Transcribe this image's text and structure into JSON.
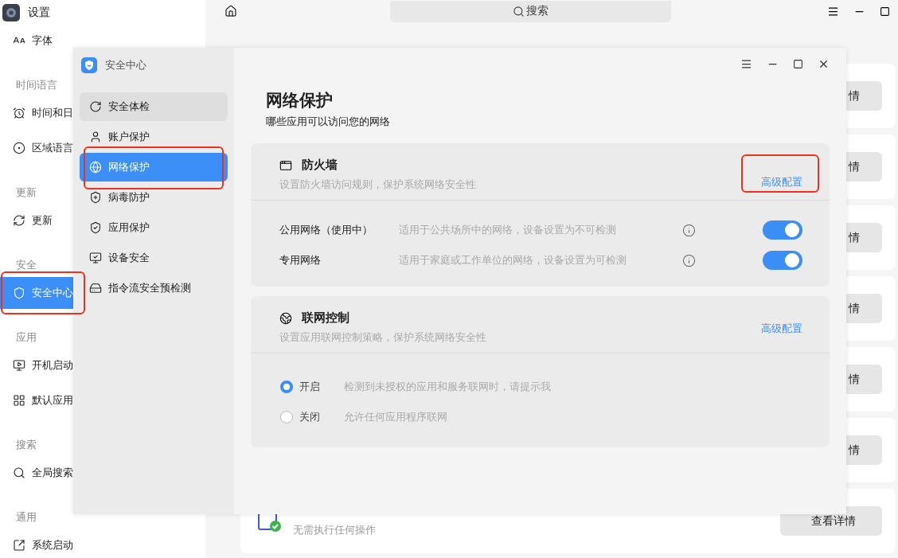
{
  "settings": {
    "title": "设置",
    "search": {
      "placeholder": "搜索"
    },
    "sidebar": [
      {
        "kind": "item",
        "label": "字体",
        "selected": false,
        "annotated": false
      },
      {
        "kind": "section",
        "label": "时间语言"
      },
      {
        "kind": "item",
        "label": "时间和日",
        "selected": false,
        "annotated": false
      },
      {
        "kind": "item",
        "label": "区域语言",
        "selected": false,
        "annotated": false
      },
      {
        "kind": "section",
        "label": "更新"
      },
      {
        "kind": "item",
        "label": "更新",
        "selected": false,
        "annotated": false
      },
      {
        "kind": "section",
        "label": "安全"
      },
      {
        "kind": "item",
        "label": "安全中心",
        "selected": true,
        "annotated": true
      },
      {
        "kind": "section",
        "label": "应用"
      },
      {
        "kind": "item",
        "label": "开机启动",
        "selected": false,
        "annotated": false
      },
      {
        "kind": "item",
        "label": "默认应用",
        "selected": false,
        "annotated": false
      },
      {
        "kind": "section",
        "label": "搜索"
      },
      {
        "kind": "item",
        "label": "全局搜索",
        "selected": false,
        "annotated": false
      },
      {
        "kind": "section",
        "label": "通用"
      },
      {
        "kind": "item",
        "label": "系统启动",
        "selected": false,
        "annotated": false
      }
    ],
    "cards": [
      {
        "button": "情"
      },
      {
        "button": "情"
      },
      {
        "button": "情"
      },
      {
        "button": "情"
      },
      {
        "button": "情"
      },
      {
        "button": "情"
      },
      {
        "description": "无需执行任何操作",
        "button": "查看详情"
      }
    ]
  },
  "dialog": {
    "title": "安全中心",
    "nav": [
      {
        "label": "安全体检",
        "selected": false,
        "hovered": true,
        "annotated": false
      },
      {
        "label": "账户保护",
        "selected": false,
        "hovered": false,
        "annotated": false
      },
      {
        "label": "网络保护",
        "selected": true,
        "hovered": false,
        "annotated": true
      },
      {
        "label": "病毒防护",
        "selected": false,
        "hovered": false,
        "annotated": false
      },
      {
        "label": "应用保护",
        "selected": false,
        "hovered": false,
        "annotated": false
      },
      {
        "label": "设备安全",
        "selected": false,
        "hovered": false,
        "annotated": false
      },
      {
        "label": "指令流安全预检测",
        "selected": false,
        "hovered": false,
        "annotated": false
      }
    ],
    "heading": "网络保护",
    "subheading": "哪些应用可以访问您的网络",
    "sections": [
      {
        "kind": "toggles",
        "title": "防火墙",
        "description": "设置防火墙访问规则，保护系统网络安全性",
        "link": "高级配置",
        "annotated": true,
        "rows": [
          {
            "label": "公用网络（使用中）",
            "description": "适用于公共场所中的网络，设备设置为不可检测",
            "on": true
          },
          {
            "label": "专用网络",
            "description": "适用于家庭或工作单位的网络，设备设置为可检测",
            "on": true
          }
        ]
      },
      {
        "kind": "radios",
        "title": "联网控制",
        "description": "设置应用联网控制策略，保护系统网络安全性",
        "link": "高级配置",
        "annotated": false,
        "options": [
          {
            "label": "开启",
            "description": "检测到未授权的应用和服务联网时，请提示我",
            "selected": true
          },
          {
            "label": "关闭",
            "description": "允许任何应用程序联网",
            "selected": false
          }
        ]
      }
    ]
  }
}
